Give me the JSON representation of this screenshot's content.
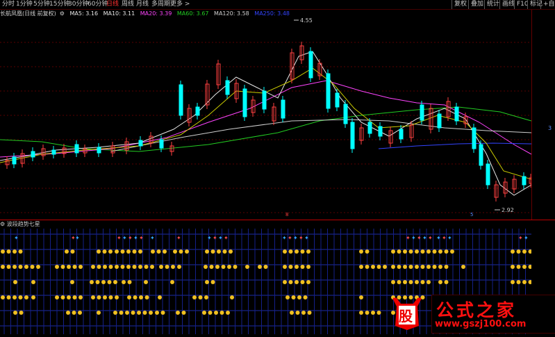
{
  "toolbar": {
    "tabs": [
      {
        "label": "分时",
        "active": false
      },
      {
        "label": "1分钟",
        "active": false
      },
      {
        "label": "5分钟",
        "active": false
      },
      {
        "label": "15分钟",
        "active": false
      },
      {
        "label": "30分钟",
        "active": false
      },
      {
        "label": "60分钟",
        "active": false
      },
      {
        "label": "日线",
        "active": true
      },
      {
        "label": "周线",
        "active": false
      },
      {
        "label": "月线",
        "active": false
      },
      {
        "label": "多周期",
        "active": false
      },
      {
        "label": "更多 >",
        "active": false
      }
    ],
    "right_buttons": [
      "复权",
      "叠加",
      "统计",
      "画线",
      "F10",
      "标记",
      "+自选"
    ]
  },
  "main_header": {
    "stock": "长航凤凰(日线 前复权)",
    "ma5": "MA5: 3.16",
    "ma10": "MA10: 3.11",
    "ma20": "MA20: 3.39",
    "ma60": "MA60: 3.67",
    "ma120": "MA120: 3.58",
    "ma250": "MA250: 3.48"
  },
  "annotations": {
    "high": "4.55",
    "low": "2.92",
    "axis_mark": "3"
  },
  "markers": {
    "a": "8",
    "b": "5"
  },
  "indicator": {
    "title": "波段趋势七星"
  },
  "watermark": {
    "text": "公式之家",
    "url": "www.gszj100.com",
    "badge": "股"
  },
  "colors": {
    "ma5": "#e8e8e8",
    "ma10": "#e6e600",
    "ma20": "#ff44ff",
    "ma60": "#22cc22",
    "ma120": "#cfcfcf",
    "ma250": "#3344ff",
    "up": "#ff4040",
    "down": "#00ffff"
  }
}
